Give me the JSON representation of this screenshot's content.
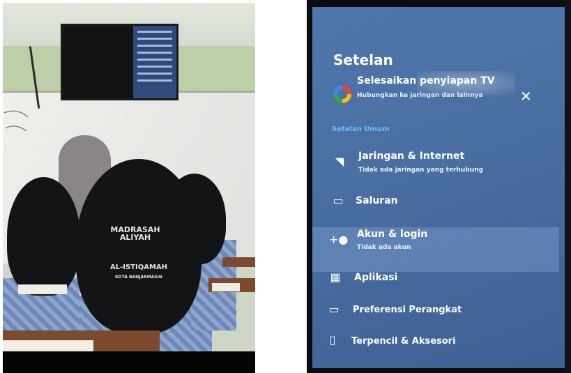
{
  "tv_settings": {
    "title": "Setelan",
    "setup": {
      "title": "Selesaikan penyiapan TV",
      "subtitle": "Hubungkan ke jaringan dan lainnya"
    },
    "section": "Setelan Umum",
    "items": [
      {
        "label": "Jaringan & Internet",
        "sub": "Tidak ada jaringan yang terhubung",
        "icon": "wifi-icon"
      },
      {
        "label": "Saluran",
        "sub": "",
        "icon": "tv-icon"
      },
      {
        "label": "Akun & login",
        "sub": "Tidak ada akun",
        "icon": "add-account-icon"
      },
      {
        "label": "Aplikasi",
        "sub": "",
        "icon": "apps-grid-icon"
      },
      {
        "label": "Preferensi Perangkat",
        "sub": "",
        "icon": "device-icon"
      },
      {
        "label": "Terpencil & Aksesori",
        "sub": "",
        "icon": "remote-icon"
      }
    ]
  },
  "uniform_print": {
    "top": "MADRASAH ALIYAH",
    "middle": "AL-ISTIQAMAH",
    "bottom": "KOTA BANJARMASIN"
  },
  "colors": {
    "screen": "#4a6fa2",
    "accent": "#6bc2ff",
    "headscarf": "#121416",
    "uniform": "#6b88b8"
  }
}
